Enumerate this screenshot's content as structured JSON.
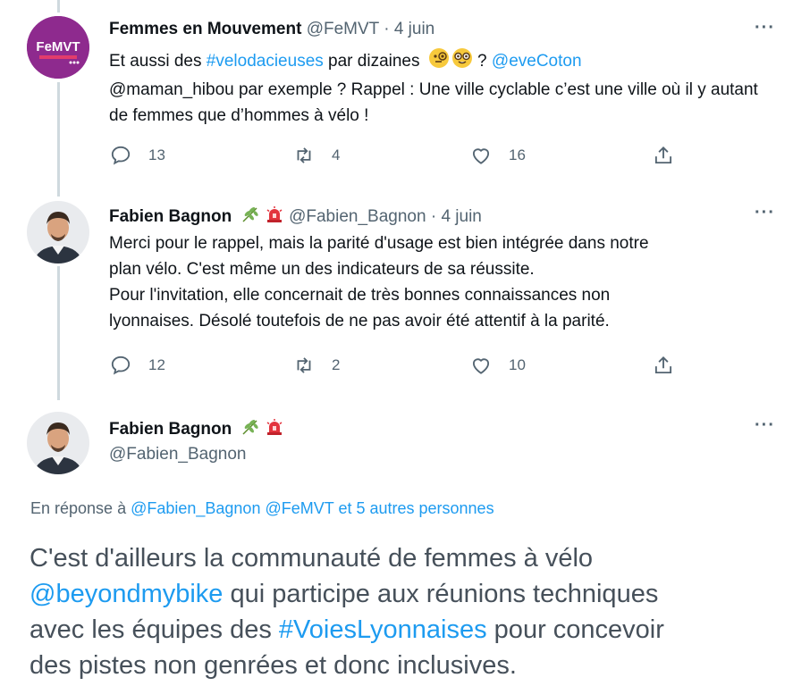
{
  "tweets": [
    {
      "name": "Femmes en Mouvement",
      "handle": "@FeMVT",
      "sep": "·",
      "date": "4 juin",
      "avatar_text": "FeMVT",
      "text_a": "Et aussi des ",
      "hashtag": "#velodacieuses",
      "text_b": " par dizaines ",
      "text_c": " ? ",
      "mention": "@eveCoton",
      "text_d": "@maman_hibou par exemple ? Rappel : Une ville cyclable c’est une ville où il y autant de femmes que d’hommes à vélo !",
      "replies": "13",
      "retweets": "4",
      "likes": "16",
      "more": "···"
    },
    {
      "name": "Fabien Bagnon",
      "handle": "@Fabien_Bagnon",
      "sep": "·",
      "date": "4 juin",
      "line1": "Merci pour le rappel, mais la parité d'usage est bien intégrée dans notre",
      "line2": "plan vélo. C'est même un des indicateurs de sa réussite.",
      "line3": "Pour l'invitation, elle concernait de très bonnes connaissances non",
      "line4": "lyonnaises. Désolé toutefois de ne pas avoir été attentif à la parité.",
      "replies": "12",
      "retweets": "2",
      "likes": "10",
      "more": "···"
    }
  ],
  "main": {
    "name": "Fabien Bagnon",
    "handle": "@Fabien_Bagnon",
    "more": "···",
    "reply_prefix": "En réponse à ",
    "reply_to_1": "@Fabien_Bagnon",
    "reply_to_2": "@FeMVT",
    "reply_others": "et 5 autres personnes",
    "text_1": "C'est d'ailleurs la communauté de femmes à vélo",
    "mention": "@beyondmybike",
    "text_2": " qui participe aux réunions techniques",
    "text_3": "avec les équipes des ",
    "hashtag": "#VoiesLyonnaises",
    "text_4": " pour concevoir",
    "text_5": "des pistes non genrées et donc inclusives."
  },
  "icons": {
    "reply": "reply-icon",
    "retweet": "retweet-icon",
    "like": "heart-icon",
    "share": "share-icon",
    "leaf": "leaf-emoji-icon",
    "siren": "siren-emoji-icon",
    "monocle": "monocle-face-emoji-icon",
    "nerd": "nerd-face-emoji-icon"
  },
  "colors": {
    "link": "#1d9bf0",
    "femvt_brand": "#8e2a8e",
    "meta": "#536471"
  }
}
